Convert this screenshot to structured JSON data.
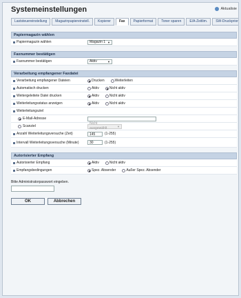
{
  "header": {
    "title": "Systemeinstellungen",
    "update": "Aktualisie"
  },
  "tabs": [
    "Laststeuereinstellung",
    "Magazinpapiereinstell.",
    "Kopierer",
    "Fax",
    "Papierformat",
    "Toner sparen",
    "E/A-Zeitlim.",
    "SW-Druckpriorität"
  ],
  "s1": {
    "head": "Papiermagazin wählen",
    "label": "Papiermagazin wählen",
    "value": "Magazin 1"
  },
  "s2": {
    "head": "Faxnummer bestätigen",
    "label": "Faxnummer bestätigen",
    "value": "Aktiv"
  },
  "s3": {
    "head": "Verarbeitung empfangener Faxdatei",
    "r1": {
      "label": "Verarbeitung empfangener Dateien",
      "o1": "Drucken",
      "o2": "Weiterleiten"
    },
    "r2": {
      "label": "Automatisch drucken",
      "o1": "Aktiv",
      "o2": "Nicht aktiv"
    },
    "r3": {
      "label": "Weitergeleitete Datei drucken",
      "o1": "Aktiv",
      "o2": "Nicht aktiv"
    },
    "r4": {
      "label": "Weiterleitungsstatus anzeigen",
      "o1": "Aktiv",
      "o2": "Nicht aktiv"
    },
    "r5": {
      "label": "Weiterleitungsziel"
    },
    "email": {
      "label": "E-Mail-Adresse",
      "value": ""
    },
    "scan": {
      "label": "Scanziel",
      "value": "Nicht ausgewählt"
    },
    "r6": {
      "label": "Anzahl Weiterleitungsversuche (Zeit)",
      "value": "145",
      "range": "(1-255)"
    },
    "r7": {
      "label": "Intervall Weiterleitungsversuche (Minute)",
      "value": "30",
      "range": "(1-255)"
    }
  },
  "s4": {
    "head": "Autorisierter Empfang",
    "r1": {
      "label": "Autorisierter Empfang",
      "o1": "Aktiv",
      "o2": "Nicht aktiv"
    },
    "r2": {
      "label": "Empfangsbedingungen",
      "o1": "Spez. Absender",
      "o2": "Außer Spez. Absender"
    }
  },
  "admin": {
    "note": "Bitte Administratorpasswort eingeben.",
    "value": ""
  },
  "buttons": {
    "ok": "OK",
    "cancel": "Abbrechen"
  }
}
